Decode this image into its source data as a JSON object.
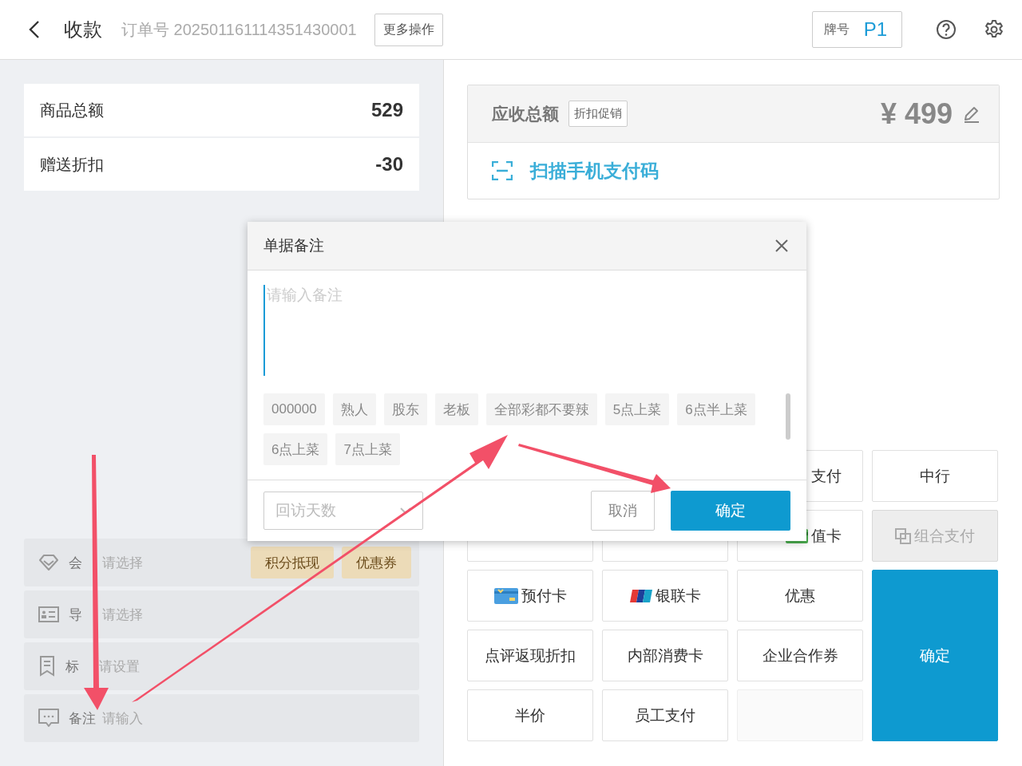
{
  "header": {
    "title": "收款",
    "order": "订单号 202501161114351430001",
    "more_button": "更多操作",
    "plate": {
      "label": "牌号",
      "value": "P1"
    }
  },
  "summary": [
    {
      "label": "商品总额",
      "value": "529"
    },
    {
      "label": "赠送折扣",
      "value": "-30"
    }
  ],
  "options": [
    {
      "kind": "member",
      "label": "会",
      "value": "请选择",
      "actions": [
        "积分抵现",
        "优惠券"
      ]
    },
    {
      "kind": "guide",
      "label": "导",
      "value": "请选择"
    },
    {
      "kind": "tag",
      "label": "标",
      "value": "请设置"
    },
    {
      "kind": "note",
      "label": "备注",
      "value": "请输入"
    }
  ],
  "receivable": {
    "label": "应收总额",
    "promo_button": "折扣促销",
    "amount": "¥ 499",
    "scan_label": "扫描手机支付码"
  },
  "payments": [
    {
      "kind": "clipped",
      "text": "支付",
      "disabled": false
    },
    {
      "kind": "plain",
      "text": "中行",
      "disabled": false
    },
    {
      "kind": "covered",
      "disabled": false
    },
    {
      "kind": "covered",
      "disabled": false
    },
    {
      "kind": "storedvalue",
      "text": "值卡",
      "disabled": false
    },
    {
      "kind": "combo",
      "text": "组合支付",
      "disabled": true
    },
    {
      "kind": "prepaid",
      "text": "预付卡",
      "disabled": false
    },
    {
      "kind": "unionpay",
      "text": "银联卡",
      "disabled": false
    },
    {
      "kind": "plain",
      "text": "优惠",
      "disabled": false
    },
    {
      "kind": "plain",
      "text": "点评返现折扣",
      "disabled": false
    },
    {
      "kind": "plain",
      "text": "内部消费卡",
      "disabled": false
    },
    {
      "kind": "plain",
      "text": "企业合作券",
      "disabled": false
    },
    {
      "kind": "plain",
      "text": "半价",
      "disabled": false
    },
    {
      "kind": "plain",
      "text": "员工支付",
      "disabled": false
    },
    {
      "kind": "blank",
      "disabled": false
    },
    {
      "kind": "primary",
      "text": "确定",
      "disabled": false
    }
  ],
  "dialog": {
    "title": "单据备注",
    "placeholder": "请输入备注",
    "tags": [
      "000000",
      "熟人",
      "股东",
      "老板",
      "全部彩都不要辣",
      "5点上菜",
      "6点半上菜",
      "6点上菜",
      "7点上菜"
    ],
    "days_placeholder": "回访天数",
    "cancel_button": "取消",
    "ok_button": "确定"
  }
}
